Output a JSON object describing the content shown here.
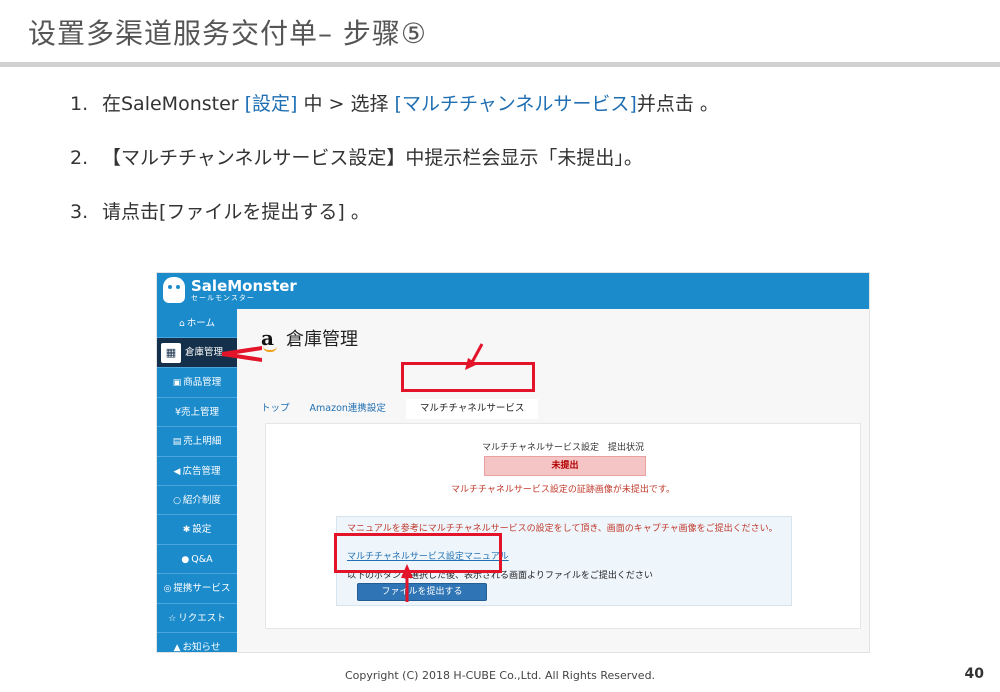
{
  "slide": {
    "title": "设置多渠道服务交付单– 步骤⑤",
    "steps": [
      {
        "num": "1.",
        "pre": "在SaleMonster ",
        "hl1": "[設定]",
        "mid": " 中 > 选择 ",
        "hl2": "[マルチチャンネルサービス]",
        "post": "并点击 。"
      },
      {
        "num": "2.",
        "text": "【マルチチャンネルサービス設定】中提示栏会显示「未提出」。"
      },
      {
        "num": "3.",
        "text": "请点击[ファイルを提出する] 。"
      }
    ],
    "footer": "Copyright (C) 2018 H-CUBE Co.,Ltd. All Rights Reserved.",
    "page_number": "40"
  },
  "app": {
    "brand": "SaleMonster",
    "brand_sub": "セールモンスター",
    "sidebar": [
      {
        "label": "ホーム",
        "icon": "home-icon",
        "glyph": "⌂"
      },
      {
        "label": "倉庫管理",
        "icon": "warehouse-icon",
        "glyph": "▦",
        "active": true
      },
      {
        "label": "商品管理",
        "icon": "box-icon",
        "glyph": "▣"
      },
      {
        "label": "¥売上管理",
        "icon": "yen-icon",
        "glyph": ""
      },
      {
        "label": "売上明細",
        "icon": "document-icon",
        "glyph": "▤"
      },
      {
        "label": "広告管理",
        "icon": "megaphone-icon",
        "glyph": "◀"
      },
      {
        "label": "紹介制度",
        "icon": "chat-icon",
        "glyph": "○"
      },
      {
        "label": "設定",
        "icon": "gear-icon",
        "glyph": "✱"
      },
      {
        "label": "Q&A",
        "icon": "comments-icon",
        "glyph": "●"
      },
      {
        "label": "提携サービス",
        "icon": "handshake-icon",
        "glyph": "◎"
      },
      {
        "label": "リクエスト",
        "icon": "star-icon",
        "glyph": "☆"
      },
      {
        "label": "お知らせ",
        "icon": "bell-icon",
        "glyph": "▲"
      }
    ],
    "page_title": "倉庫管理",
    "amazon_mark": "a",
    "tabs": [
      "トップ",
      "Amazon連携設定",
      "マルチチャネルサービス"
    ],
    "panel": {
      "status_label": "マルチチャネルサービス設定　提出状況",
      "status_value": "未提出",
      "status_message": "マルチチャネルサービス設定の証跡画像が未提出です。",
      "info_text": "マニュアルを参考にマルチチャネルサービスの設定をして頂き、画面のキャプチャ画像をご提出ください。",
      "manual_link": "マルチチャネルサービス設定マニュアル",
      "note": "以下のボタンを選択した後、表示される画面よりファイルをご提出ください",
      "submit_button": "ファイルを提出する"
    }
  },
  "colors": {
    "accent_blue": "#1b8bcc",
    "highlight_red": "#e3142a",
    "sidebar_active": "#15304a"
  }
}
